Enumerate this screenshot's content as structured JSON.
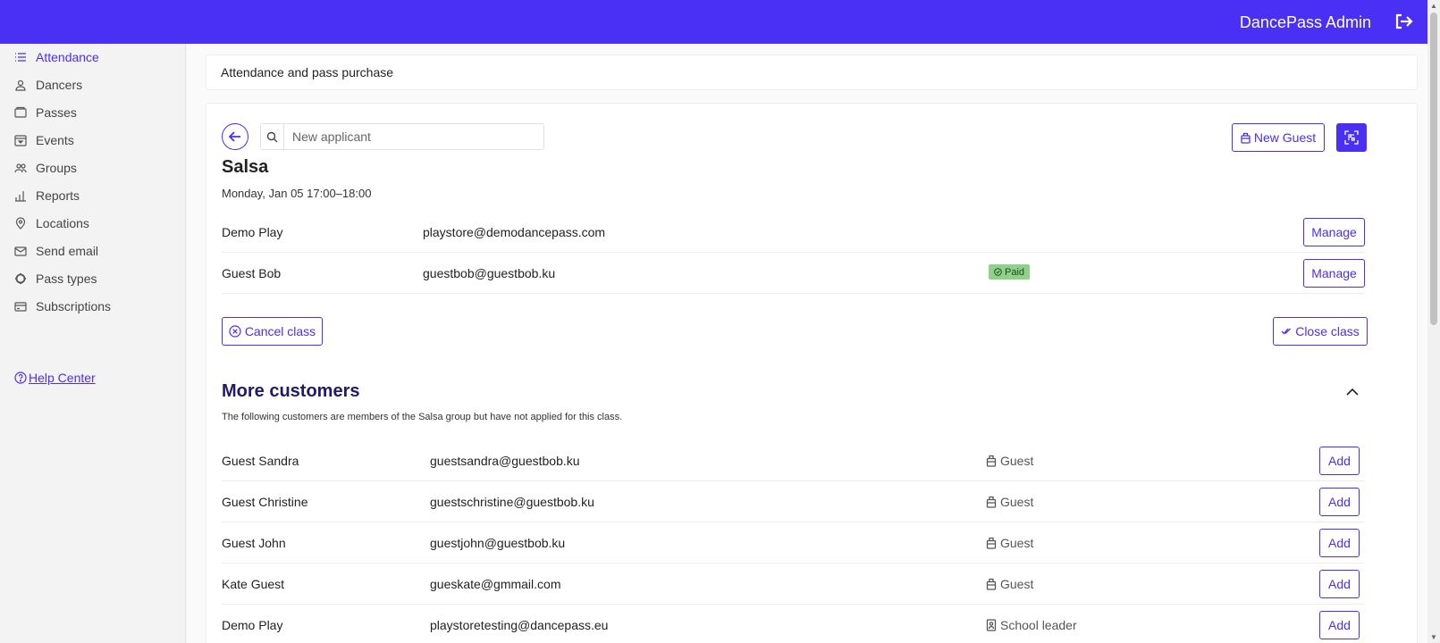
{
  "header": {
    "title": "DancePass Admin",
    "logout_icon": "logout-icon"
  },
  "sidebar": {
    "items": [
      {
        "label": "Attendance",
        "icon": "list-icon",
        "active": true
      },
      {
        "label": "Dancers",
        "icon": "user-icon"
      },
      {
        "label": "Passes",
        "icon": "pass-icon"
      },
      {
        "label": "Events",
        "icon": "calendar-icon"
      },
      {
        "label": "Groups",
        "icon": "group-icon"
      },
      {
        "label": "Reports",
        "icon": "chart-icon"
      },
      {
        "label": "Locations",
        "icon": "location-icon"
      },
      {
        "label": "Send email",
        "icon": "mail-icon"
      },
      {
        "label": "Pass types",
        "icon": "gear-icon"
      },
      {
        "label": "Subscriptions",
        "icon": "card-icon"
      }
    ],
    "help_label": "Help Center"
  },
  "breadcrumb": "Attendance and pass purchase",
  "search": {
    "placeholder": "New applicant",
    "value": ""
  },
  "toolbar": {
    "new_guest_label": "New Guest",
    "qr_icon": "qr-scan-icon"
  },
  "class_info": {
    "title": "Salsa",
    "time": "Monday, Jan 05 17:00–18:00"
  },
  "attendees": [
    {
      "name": "Demo Play",
      "email": "playstore@demodancepass.com",
      "status": "",
      "action": "Manage"
    },
    {
      "name": "Guest Bob",
      "email": "guestbob@guestbob.ku",
      "status": "Paid",
      "action": "Manage"
    }
  ],
  "class_actions": {
    "cancel_label": "Cancel class",
    "close_label": "Close class"
  },
  "more_customers": {
    "title": "More customers",
    "description": "The following customers are members of the Salsa group but have not applied for this class.",
    "items": [
      {
        "name": "Guest Sandra",
        "email": "guestsandra@guestbob.ku",
        "role": "Guest",
        "action": "Add"
      },
      {
        "name": "Guest Christine",
        "email": "guestschristine@guestbob.ku",
        "role": "Guest",
        "action": "Add"
      },
      {
        "name": "Guest John",
        "email": "guestjohn@guestbob.ku",
        "role": "Guest",
        "action": "Add"
      },
      {
        "name": "Kate Guest",
        "email": "gueskate@gmmail.com",
        "role": "Guest",
        "action": "Add"
      },
      {
        "name": "Demo Play",
        "email": "playstoretesting@dancepass.eu",
        "role": "School leader",
        "action": "Add"
      }
    ]
  },
  "colors": {
    "accent": "#4a2ff5",
    "paid_badge": "#8fd08a",
    "section_title": "#1f1a6b"
  }
}
